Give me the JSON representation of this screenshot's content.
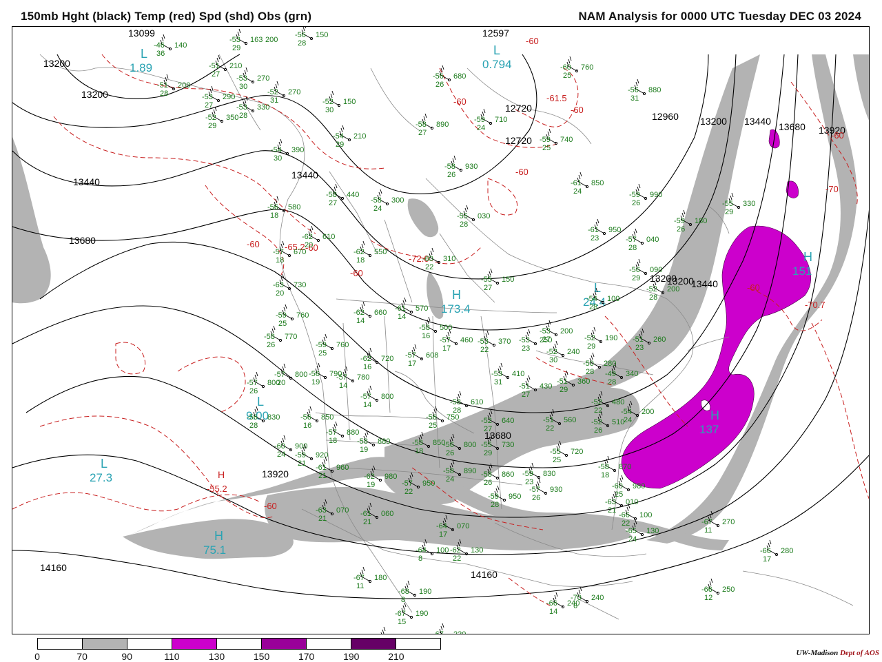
{
  "header": {
    "left_title": "150mb Hght (black) Temp (red) Spd (shd) Obs (grn)",
    "right_title": "NAM Analysis for 0000 UTC Tuesday  DEC 03 2024"
  },
  "colors": {
    "height_contour": "#000000",
    "temperature_contour": "#c81e1e",
    "speed_shade_70": "#b3b3b3",
    "speed_shade_110": "#cc00cc",
    "speed_shade_150": "#990099",
    "speed_shade_190": "#660066",
    "obs": "#1a7a1a",
    "extrema_labels": "#2aa3b3",
    "borders": "#888888"
  },
  "legend": {
    "labels": [
      "0",
      "70",
      "90",
      "110",
      "130",
      "150",
      "170",
      "190",
      "210"
    ],
    "colors": [
      "#ffffff",
      "#b3b3b3",
      "#ffffff",
      "#cc00cc",
      "#ffffff",
      "#990099",
      "#ffffff",
      "#660066",
      "#ffffff"
    ]
  },
  "credit": {
    "org": "UW-Madison",
    "dept": "Dept of AOS"
  },
  "map": {
    "height_labels": [
      "13099",
      "12597",
      "13200",
      "13200",
      "12720",
      "12720",
      "12960",
      "13200",
      "13440",
      "13680",
      "13920",
      "13440",
      "13440",
      "13680",
      "13200",
      "13200",
      "13440",
      "13680",
      "13920",
      "14160",
      "14160"
    ],
    "temp_labels": [
      "-60",
      "-61.5",
      "-60",
      "-60",
      "-60",
      "-60",
      "-65.2",
      "-60",
      "-72.0",
      "-70",
      "-60",
      "-70.7",
      "-60",
      "-60",
      "-60"
    ],
    "extrema": [
      {
        "sym": "L",
        "value": "1.89"
      },
      {
        "sym": "L",
        "value": "0.794"
      },
      {
        "sym": "L",
        "value": "24.4"
      },
      {
        "sym": "H",
        "value": "173.4"
      },
      {
        "sym": "L",
        "value": "9.00"
      },
      {
        "sym": "L",
        "value": "27.3"
      },
      {
        "sym": "H",
        "value": "75.1"
      },
      {
        "sym": "H",
        "value": "151"
      },
      {
        "sym": "H",
        "value": "137"
      },
      {
        "sym": "H",
        "value": "-55.2"
      }
    ],
    "obs": [
      [
        "-46",
        "36",
        "140"
      ],
      [
        "-53",
        "29",
        "163",
        "200"
      ],
      [
        "-56",
        "28",
        "150"
      ],
      [
        "-51",
        "27",
        "210"
      ],
      [
        "-53",
        "30",
        "270"
      ],
      [
        "-51",
        "28",
        "200"
      ],
      [
        "-53",
        "27",
        "290"
      ],
      [
        "-52",
        "31",
        "270"
      ],
      [
        "-53",
        "28",
        "330"
      ],
      [
        "-52",
        "30",
        "150"
      ],
      [
        "-52",
        "29",
        "350"
      ],
      [
        "-54",
        "29",
        "210"
      ],
      [
        "-54",
        "30",
        "390"
      ],
      [
        "-56",
        "26",
        "680"
      ],
      [
        "-58",
        "27",
        "890"
      ],
      [
        "-59",
        "24",
        "710"
      ],
      [
        "-60",
        "25",
        "760"
      ],
      [
        "-56",
        "31",
        "880"
      ],
      [
        "-59",
        "25",
        "740"
      ],
      [
        "-58",
        "26",
        "930"
      ],
      [
        "-61",
        "24",
        "850"
      ],
      [
        "-59",
        "26",
        "990"
      ],
      [
        "-55",
        "29",
        "330"
      ],
      [
        "-58",
        "24",
        "300"
      ],
      [
        "-58",
        "27",
        "440"
      ],
      [
        "-55",
        "28",
        "030"
      ],
      [
        "-59",
        "26",
        "180"
      ],
      [
        "-61",
        "23",
        "950"
      ],
      [
        "-57",
        "28",
        "040"
      ],
      [
        "-56",
        "18",
        "580"
      ],
      [
        "-62",
        "20",
        "610"
      ],
      [
        "-57",
        "18",
        "670"
      ],
      [
        "-62",
        "18",
        "550"
      ],
      [
        "-60",
        "22",
        "310"
      ],
      [
        "-55",
        "27",
        "150"
      ],
      [
        "-56",
        "29",
        "090"
      ],
      [
        "-63",
        "20",
        "730"
      ],
      [
        "-62",
        "14",
        "660"
      ],
      [
        "-61",
        "14",
        "570"
      ],
      [
        "-54",
        "28",
        "100"
      ],
      [
        "-52",
        "28",
        "200"
      ],
      [
        "-59",
        "25",
        "760"
      ],
      [
        "-58",
        "26",
        "770"
      ],
      [
        "-59",
        "25",
        "760"
      ],
      [
        "-58",
        "16",
        "500"
      ],
      [
        "-57",
        "17",
        "460"
      ],
      [
        "-53",
        "22",
        "370"
      ],
      [
        "-53",
        "23",
        "250"
      ],
      [
        "-53",
        "27",
        "200"
      ],
      [
        "-52",
        "30",
        "240"
      ],
      [
        "-52",
        "29",
        "190"
      ],
      [
        "-51",
        "23",
        "260"
      ],
      [
        "-62",
        "16",
        "720"
      ],
      [
        "-57",
        "17",
        "608"
      ],
      [
        "-57",
        "20",
        "800"
      ],
      [
        "-56",
        "19",
        "790"
      ],
      [
        "-57",
        "14",
        "780"
      ],
      [
        "-53",
        "31",
        "410"
      ],
      [
        "-51",
        "27",
        "430"
      ],
      [
        "-51",
        "29",
        "360"
      ],
      [
        "-50",
        "28",
        "280"
      ],
      [
        "-49",
        "28",
        "340"
      ],
      [
        "-57",
        "26",
        "800"
      ],
      [
        "-57",
        "14",
        "800"
      ],
      [
        "-56",
        "28",
        "830"
      ],
      [
        "-56",
        "16",
        "850"
      ],
      [
        "-57",
        "18",
        "880"
      ],
      [
        "-56",
        "25",
        "750"
      ],
      [
        "-58",
        "28",
        "610"
      ],
      [
        "-52",
        "27",
        "640"
      ],
      [
        "-51",
        "22",
        "560"
      ],
      [
        "-52",
        "22",
        "480"
      ],
      [
        "-52",
        "26",
        "510"
      ],
      [
        "-54",
        "24",
        "200"
      ],
      [
        "-60",
        "24",
        "900"
      ],
      [
        "-59",
        "21",
        "920"
      ],
      [
        "-58",
        "19",
        "880"
      ],
      [
        "-58",
        "18",
        "850"
      ],
      [
        "-56",
        "26",
        "800"
      ],
      [
        "-55",
        "29",
        "730"
      ],
      [
        "-55",
        "25",
        "720"
      ],
      [
        "-61",
        "21",
        "960"
      ],
      [
        "-62",
        "19",
        "980"
      ],
      [
        "-57",
        "22",
        "950"
      ],
      [
        "-58",
        "24",
        "890"
      ],
      [
        "-58",
        "26",
        "860"
      ],
      [
        "-59",
        "23",
        "830"
      ],
      [
        "-58",
        "18",
        "870"
      ],
      [
        "-59",
        "28",
        "950"
      ],
      [
        "-57",
        "26",
        "930"
      ],
      [
        "-60",
        "25",
        "980"
      ],
      [
        "-63",
        "21",
        "010"
      ],
      [
        "-63",
        "21",
        "070"
      ],
      [
        "-61",
        "21",
        "060"
      ],
      [
        "-64",
        "17",
        "070"
      ],
      [
        "-66",
        "22",
        "100"
      ],
      [
        "-65",
        "24",
        "130"
      ],
      [
        "-67",
        "11",
        "270"
      ],
      [
        "-66",
        "17",
        "280"
      ],
      [
        "-64",
        "8",
        "100"
      ],
      [
        "-62",
        "22",
        "130"
      ],
      [
        "-67",
        "11",
        "180"
      ],
      [
        "-68",
        "8",
        "190"
      ],
      [
        "-67",
        "15",
        "190"
      ],
      [
        "-65",
        "9",
        "220"
      ],
      [
        "-67",
        "11",
        "220"
      ],
      [
        "-66",
        "14",
        "240"
      ],
      [
        "-70",
        "6",
        "240"
      ],
      [
        "-66",
        "12",
        "250"
      ]
    ]
  }
}
